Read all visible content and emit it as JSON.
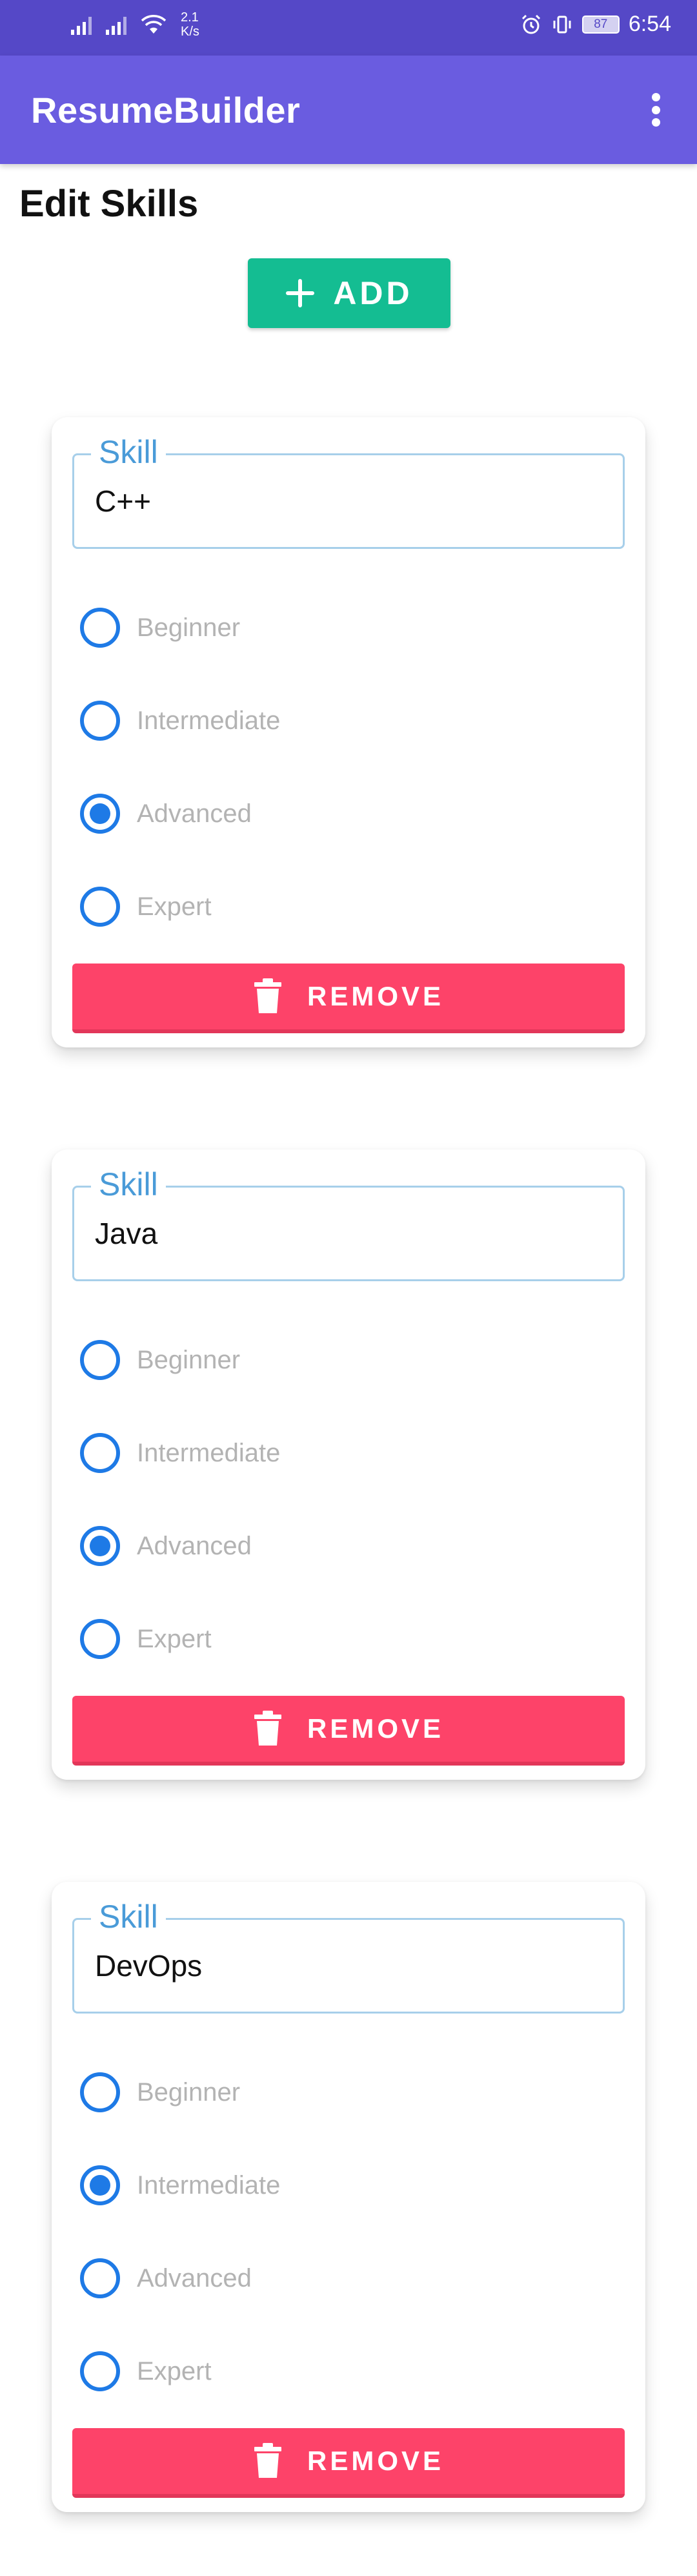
{
  "status_bar": {
    "net_speed_value": "2.1",
    "net_speed_unit": "K/s",
    "battery": "87",
    "time": "6:54"
  },
  "app_bar": {
    "title": "ResumeBuilder"
  },
  "page": {
    "heading": "Edit Skills",
    "add_label": "ADD"
  },
  "skills": [
    {
      "field_label": "Skill",
      "value": "C++",
      "levels": [
        "Beginner",
        "Intermediate",
        "Advanced",
        "Expert"
      ],
      "selected": "Advanced",
      "remove_label": "REMOVE"
    },
    {
      "field_label": "Skill",
      "value": "Java",
      "levels": [
        "Beginner",
        "Intermediate",
        "Advanced",
        "Expert"
      ],
      "selected": "Advanced",
      "remove_label": "REMOVE"
    },
    {
      "field_label": "Skill",
      "value": "DevOps",
      "levels": [
        "Beginner",
        "Intermediate",
        "Advanced",
        "Expert"
      ],
      "selected": "Intermediate",
      "remove_label": "REMOVE"
    }
  ],
  "colors": {
    "status_bar": "#5548c7",
    "app_bar": "#6a5ce0",
    "add_button": "#14bd92",
    "remove_button": "#fd4369",
    "radio": "#1e7ae6",
    "field_border": "#a7cfea",
    "field_label": "#4a9bd8"
  }
}
